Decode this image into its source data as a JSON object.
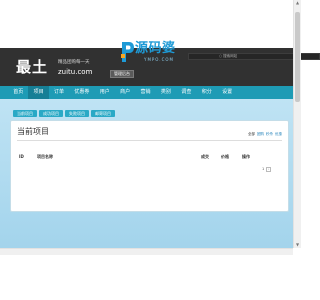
{
  "header": {
    "search_placeholder": "○ 搜索网站",
    "logo_title": "最土",
    "slogan": "精品团购每一天",
    "logo_domain": "zuitu.com",
    "admin_tag": "管理后台"
  },
  "nav": {
    "items": [
      {
        "label": "首页",
        "active": false
      },
      {
        "label": "项目",
        "active": true
      },
      {
        "label": "订单",
        "active": false
      },
      {
        "label": "优惠券",
        "active": false
      },
      {
        "label": "用户",
        "active": false
      },
      {
        "label": "商户",
        "active": false
      },
      {
        "label": "营销",
        "active": false
      },
      {
        "label": "类别",
        "active": false
      },
      {
        "label": "调查",
        "active": false
      },
      {
        "label": "积分",
        "active": false
      },
      {
        "label": "设置",
        "active": false
      }
    ]
  },
  "subtabs": [
    "当前项目",
    "成功项目",
    "失败项目",
    "邮寄项目"
  ],
  "panel": {
    "title": "当前项目",
    "actions_label": "全部",
    "actions": [
      "团购",
      "秒杀",
      "优惠"
    ],
    "columns": [
      "ID",
      "项目名称",
      "成交",
      "价格",
      "操作"
    ],
    "pager_page": "1"
  },
  "watermark": {
    "text": "源码婆",
    "sub": "YMPO.COM"
  },
  "colors": {
    "header_bg": "#313131",
    "nav_bg": "#1e9bb5",
    "nav_active": "#167f96",
    "content_bg": "#a9d8ee",
    "watermark": "#1e9ad6"
  }
}
